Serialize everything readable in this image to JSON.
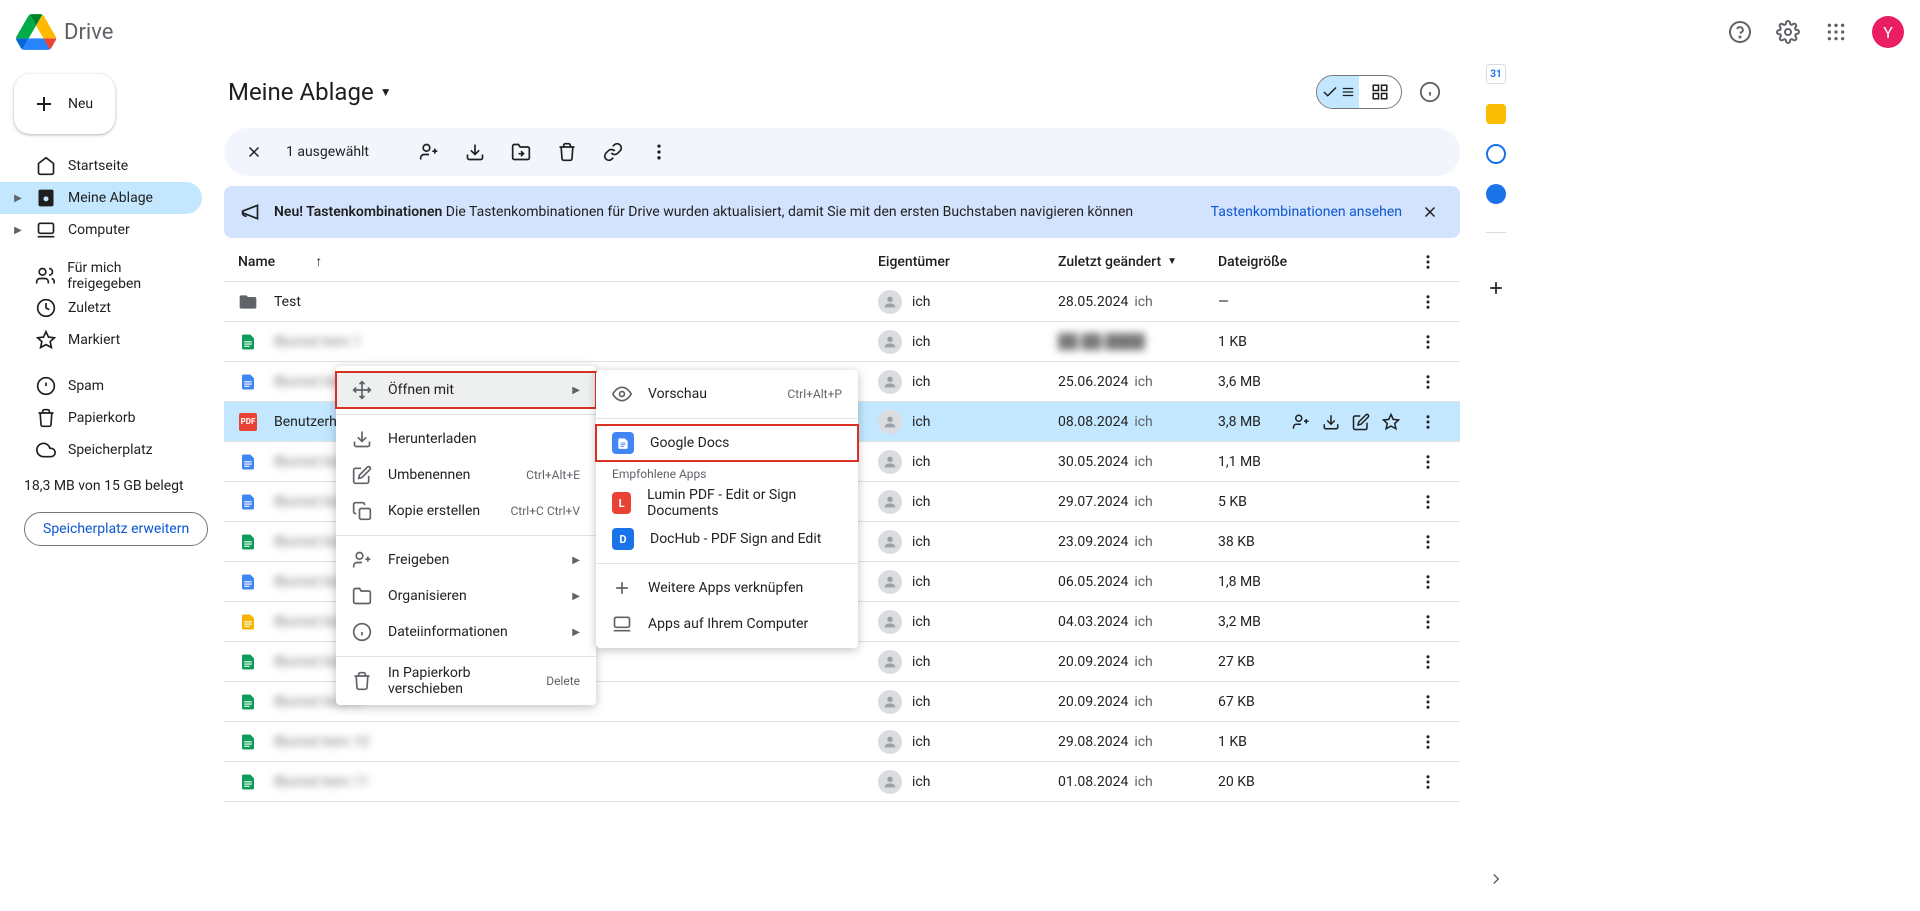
{
  "header": {
    "app_name": "Drive",
    "avatar_letter": "Y"
  },
  "sidebar": {
    "new_label": "Neu",
    "items": [
      {
        "label": "Startseite"
      },
      {
        "label": "Meine Ablage"
      },
      {
        "label": "Computer"
      },
      {
        "label": "Für mich freigegeben"
      },
      {
        "label": "Zuletzt"
      },
      {
        "label": "Markiert"
      },
      {
        "label": "Spam"
      },
      {
        "label": "Papierkorb"
      },
      {
        "label": "Speicherplatz"
      }
    ],
    "storage_text": "18,3 MB von 15 GB belegt",
    "storage_btn": "Speicherplatz erweitern"
  },
  "page": {
    "title": "Meine Ablage",
    "selection_text": "1 ausgewählt",
    "banner_bold": "Neu! Tastenkombinationen",
    "banner_text": "Die Tastenkombinationen für Drive wurden aktualisiert, damit Sie mit den ersten Buchstaben navigieren können",
    "banner_link": "Tastenkombinationen ansehen"
  },
  "columns": {
    "name": "Name",
    "owner": "Eigentümer",
    "modified": "Zuletzt geändert",
    "size": "Dateigröße"
  },
  "owner_me": "ich",
  "mod_me": "ich",
  "files": [
    {
      "name": "Test",
      "type": "folder",
      "mod": "28.05.2024",
      "size": "—",
      "blur": false
    },
    {
      "name": "Blurred item 1",
      "type": "sheets",
      "mod": "",
      "size": "1 KB",
      "blur": true
    },
    {
      "name": "Blurred item 2",
      "type": "docs",
      "mod": "25.06.2024",
      "size": "3,6 MB",
      "blur": true
    },
    {
      "name": "Benutzerhandbuch-win.pdf",
      "type": "pdf",
      "mod": "08.08.2024",
      "size": "3,8 MB",
      "blur": false,
      "selected": true
    },
    {
      "name": "Blurred item 3",
      "type": "docs",
      "mod": "30.05.2024",
      "size": "1,1 MB",
      "blur": true
    },
    {
      "name": "Blurred item 4",
      "type": "docs",
      "mod": "29.07.2024",
      "size": "5 KB",
      "blur": true
    },
    {
      "name": "Blurred item 5",
      "type": "sheets",
      "mod": "23.09.2024",
      "size": "38 KB",
      "blur": true
    },
    {
      "name": "Blurred item 6",
      "type": "docs",
      "mod": "06.05.2024",
      "size": "1,8 MB",
      "blur": true
    },
    {
      "name": "Blurred item 7",
      "type": "slides",
      "mod": "04.03.2024",
      "size": "3,2 MB",
      "blur": true
    },
    {
      "name": "Blurred item 8",
      "type": "sheets",
      "mod": "20.09.2024",
      "size": "27 KB",
      "blur": true
    },
    {
      "name": "Blurred item 9",
      "type": "sheets",
      "mod": "20.09.2024",
      "size": "67 KB",
      "blur": true
    },
    {
      "name": "Blurred item 10",
      "type": "sheets",
      "mod": "29.08.2024",
      "size": "1 KB",
      "blur": true
    },
    {
      "name": "Blurred item 11",
      "type": "sheets",
      "mod": "01.08.2024",
      "size": "20 KB",
      "blur": true
    }
  ],
  "context": {
    "open_with": "Öffnen mit",
    "download": "Herunterladen",
    "rename": "Umbenennen",
    "rename_sc": "Ctrl+Alt+E",
    "copy": "Kopie erstellen",
    "copy_sc": "Ctrl+C Ctrl+V",
    "share": "Freigeben",
    "organize": "Organisieren",
    "info": "Dateiinformationen",
    "trash": "In Papierkorb verschieben",
    "trash_sc": "Delete"
  },
  "submenu": {
    "preview": "Vorschau",
    "preview_sc": "Ctrl+Alt+P",
    "gdocs": "Google Docs",
    "recommended": "Empfohlene Apps",
    "lumin": "Lumin PDF - Edit or Sign Documents",
    "dochub": "DocHub - PDF Sign and Edit",
    "more_apps": "Weitere Apps verknüpfen",
    "desktop_apps": "Apps auf Ihrem Computer"
  }
}
